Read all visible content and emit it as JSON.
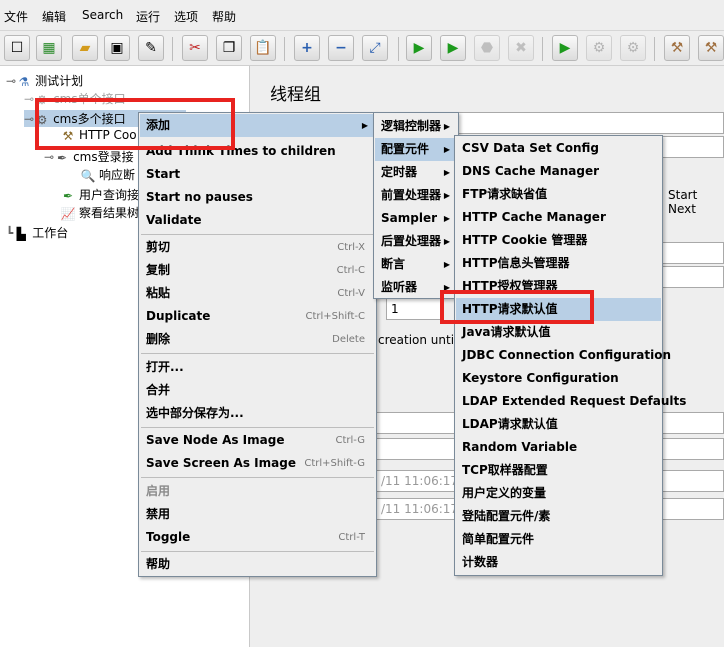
{
  "menubar": [
    "文件",
    "编辑",
    "Search",
    "运行",
    "选项",
    "帮助"
  ],
  "toolbar": {
    "icons": [
      "new-icon",
      "templates-icon",
      "open-icon",
      "save-icon",
      "edit-icon",
      "cut-icon",
      "copy-icon",
      "paste-icon",
      "expand-icon",
      "collapse-icon",
      "toggle-icon",
      "start-icon",
      "start-no-pause-icon",
      "stop-icon",
      "shutdown-icon",
      "remote-start-icon",
      "remote-stop-icon",
      "remote-shutdown-icon",
      "clear-icon",
      "clear-all-icon"
    ]
  },
  "tree": {
    "test_plan": "测试计划",
    "thread_group_single": "cms单个接口",
    "thread_group_multi": "cms多个接口",
    "http_cookie": "HTTP Coo",
    "cms_login": "cms登录接",
    "response_assert": "响应断",
    "user_query": "用户查询接",
    "view_results": "察看结果树",
    "workbench": "工作台"
  },
  "right_panel": {
    "title": "线程组",
    "start_next": "Start Next",
    "loop_value": "1",
    "creation_text": "creation until n",
    "time_1": "/11 11:06:17",
    "time_2": "/11 11:06:17"
  },
  "context_menu": {
    "items": [
      {
        "label": "添加",
        "shortcut": ""
      },
      {
        "label": "Add Think Times to children",
        "shortcut": ""
      },
      {
        "label": "Start",
        "shortcut": ""
      },
      {
        "label": "Start no pauses",
        "shortcut": ""
      },
      {
        "label": "Validate",
        "shortcut": ""
      },
      {
        "label": "剪切",
        "shortcut": "Ctrl-X"
      },
      {
        "label": "复制",
        "shortcut": "Ctrl-C"
      },
      {
        "label": "粘贴",
        "shortcut": "Ctrl-V"
      },
      {
        "label": "Duplicate",
        "shortcut": "Ctrl+Shift-C"
      },
      {
        "label": "删除",
        "shortcut": "Delete"
      },
      {
        "label": "打开...",
        "shortcut": ""
      },
      {
        "label": "合并",
        "shortcut": ""
      },
      {
        "label": "选中部分保存为...",
        "shortcut": ""
      },
      {
        "label": "Save Node As Image",
        "shortcut": "Ctrl-G"
      },
      {
        "label": "Save Screen As Image",
        "shortcut": "Ctrl+Shift-G"
      },
      {
        "label": "启用",
        "shortcut": ""
      },
      {
        "label": "禁用",
        "shortcut": ""
      },
      {
        "label": "Toggle",
        "shortcut": "Ctrl-T"
      },
      {
        "label": "帮助",
        "shortcut": ""
      }
    ]
  },
  "add_submenu": [
    "逻辑控制器",
    "配置元件",
    "定时器",
    "前置处理器",
    "Sampler",
    "后置处理器",
    "断言",
    "监听器"
  ],
  "config_submenu": [
    "CSV Data Set Config",
    "DNS Cache Manager",
    "FTP请求缺省值",
    "HTTP Cache Manager",
    "HTTP Cookie 管理器",
    "HTTP信息头管理器",
    "HTTP授权管理器",
    "HTTP请求默认值",
    "Java请求默认值",
    "JDBC Connection Configuration",
    "Keystore Configuration",
    "LDAP Extended Request Defaults",
    "LDAP请求默认值",
    "Random Variable",
    "TCP取样器配置",
    "用户定义的变量",
    "登陆配置元件/素",
    "简单配置元件",
    "计数器"
  ],
  "colors": {
    "highlight_box": "#e8231f",
    "selection": "#b8cfe5"
  }
}
